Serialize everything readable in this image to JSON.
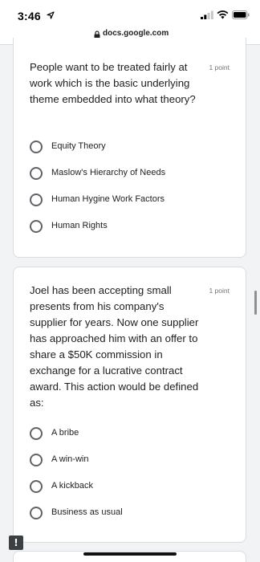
{
  "status_bar": {
    "time": "3:46"
  },
  "browser": {
    "url": "docs.google.com"
  },
  "questions": [
    {
      "text": "People want to be treated fairly at work which is the basic underlying theme embedded into what theory?",
      "points": "1 point",
      "options": [
        "Equity Theory",
        "Maslow's Hierarchy of Needs",
        "Human Hygine Work Factors",
        "Human Rights"
      ]
    },
    {
      "text": "Joel has been accepting small presents from his company's supplier for years. Now one supplier has approached him with an offer to share a $50K commission in exchange for a lucrative contract award. This action would be defined as:",
      "points": "1 point",
      "options": [
        "A bribe",
        "A win-win",
        "A kickback",
        "Business as usual"
      ]
    }
  ],
  "feedback": {
    "label": "!"
  }
}
